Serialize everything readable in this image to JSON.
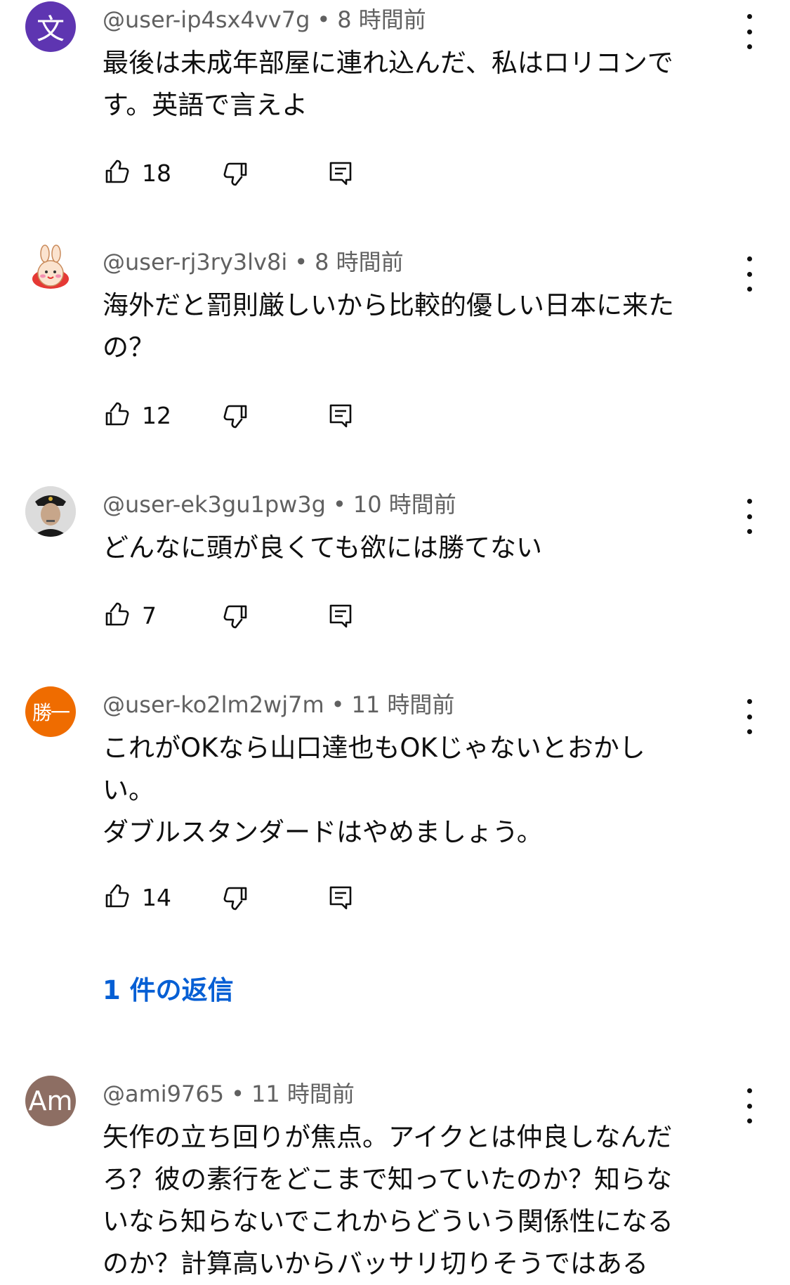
{
  "comments": [
    {
      "avatar_letter": "文",
      "handle": "@user-ip4sx4vv7g",
      "time": "8 時間前",
      "text": "最後は未成年部屋に連れ込んだ、私はロリコンで\nす。英語で言えよ",
      "likes": "18"
    },
    {
      "avatar_letter": "",
      "avatar_icon": "cartoon-character-icon",
      "handle": "@user-rj3ry3lv8i",
      "time": "8 時間前",
      "text": "海外だと罰則厳しいから比較的優しい日本に来た\nの？",
      "likes": "12"
    },
    {
      "avatar_letter": "",
      "avatar_icon": "person-photo-icon",
      "handle": "@user-ek3gu1pw3g",
      "time": "10 時間前",
      "text": "どんなに頭が良くても欲には勝てない",
      "likes": "7"
    },
    {
      "avatar_letter": "勝一",
      "handle": "@user-ko2lm2wj7m",
      "time": "11 時間前",
      "text": "これがOKなら山口達也もOKじゃないとおかし\nい。\nダブルスタンダードはやめましょう。",
      "likes": "14",
      "replies_label": "1 件の返信"
    },
    {
      "avatar_letter": "Am",
      "handle": "@ami9765",
      "time": "11 時間前",
      "text": "矢作の立ち回りが焦点。アイクとは仲良しなんだ\nろ？彼の素行をどこまで知っていたのか？知らな\nいなら知らないでこれからどういう関係性になる\nのか？計算高いからバッサリ切りそうではある"
    }
  ],
  "separator": "•",
  "colors": {
    "link_blue": "#065fd4",
    "meta_gray": "#606060",
    "text": "#0f0f0f"
  }
}
